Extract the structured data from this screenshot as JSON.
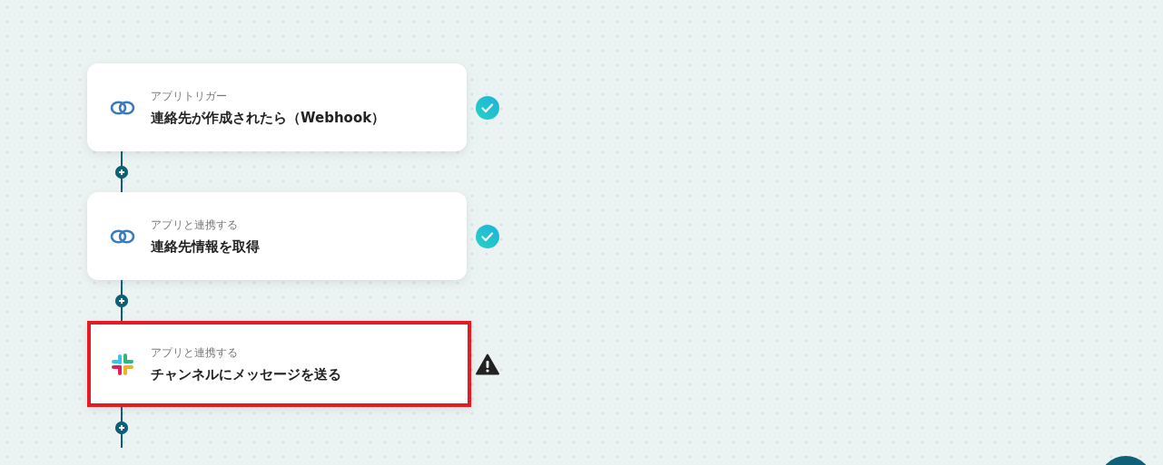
{
  "steps": [
    {
      "kind": "chain",
      "subtitle": "アプリトリガー",
      "title": "連絡先が作成されたら（Webhook）",
      "status": {
        "kind": "done"
      },
      "highlighted": false
    },
    {
      "kind": "chain",
      "subtitle": "アプリと連携する",
      "title": "連絡先情報を取得",
      "status": {
        "kind": "done"
      },
      "highlighted": false
    },
    {
      "kind": "slack",
      "subtitle": "アプリと連携する",
      "title": "チャンネルにメッセージを送る",
      "status": {
        "kind": "warning"
      },
      "highlighted": true
    }
  ]
}
